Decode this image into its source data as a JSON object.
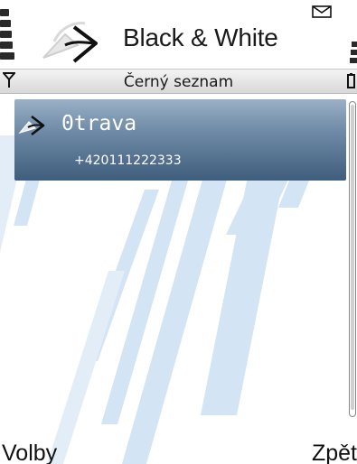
{
  "header": {
    "app_title": "Black & White",
    "logo_icon": "black-white-logo-icon",
    "mail_icon": "envelope-icon"
  },
  "nav": {
    "title": "Černý seznam",
    "signal_icon": "antenna-icon",
    "battery_icon": "battery-icon"
  },
  "list": {
    "items": [
      {
        "name": "0trava",
        "number": "+420111222333",
        "icon": "black-white-logo-icon"
      }
    ]
  },
  "softkeys": {
    "left": "Volby",
    "right": "Zpět"
  },
  "colors": {
    "selected_top": "#9ab0c6",
    "selected_bottom": "#3f5d7c",
    "stripe": "#d3e4f4"
  }
}
